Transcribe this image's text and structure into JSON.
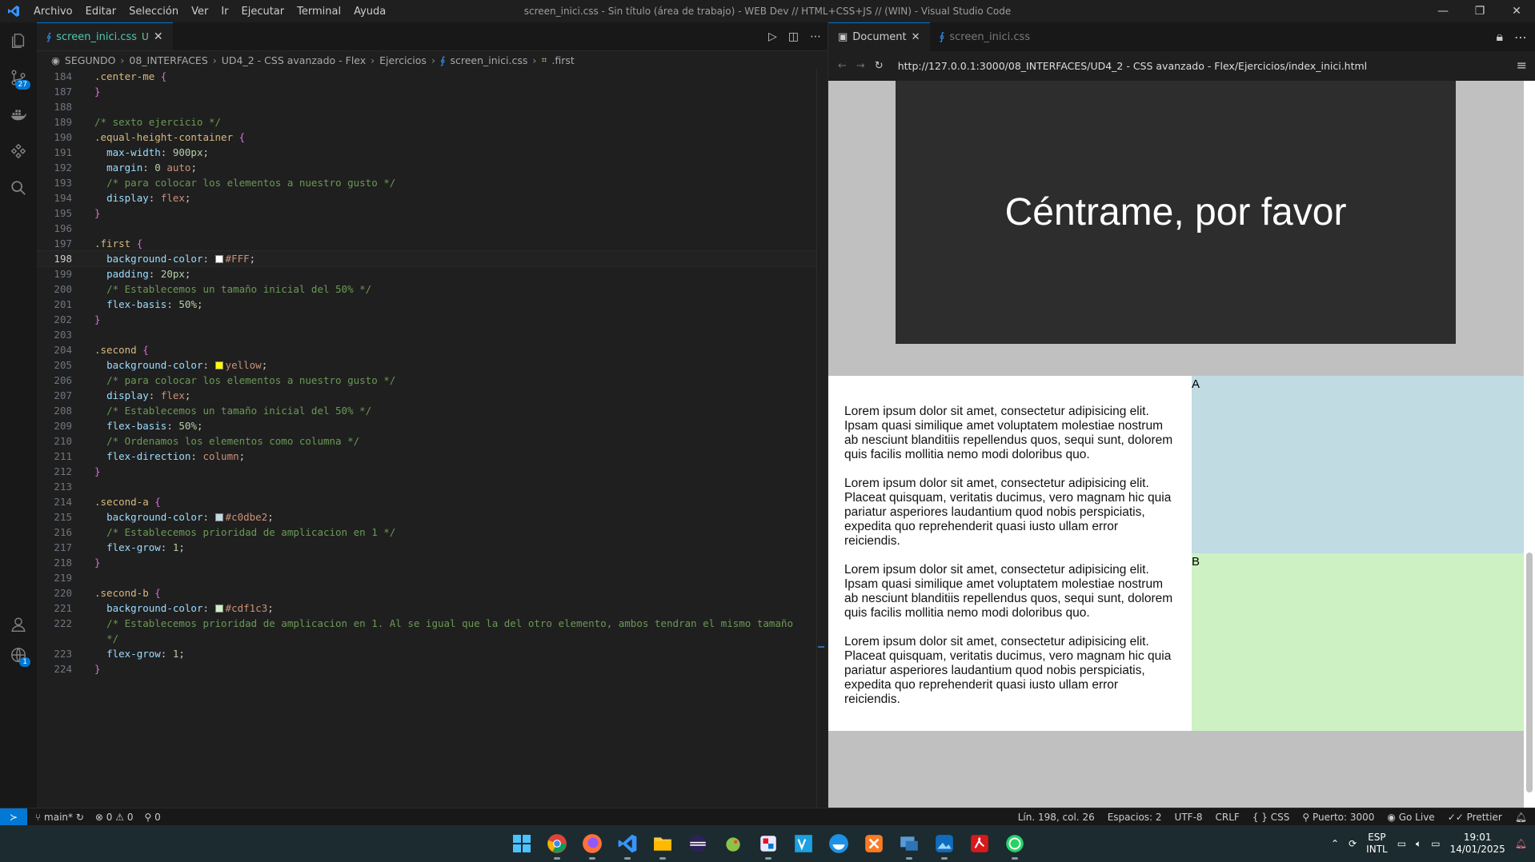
{
  "titlebar": {
    "menu": [
      "Archivo",
      "Editar",
      "Selección",
      "Ver",
      "Ir",
      "Ejecutar",
      "Terminal",
      "Ayuda"
    ],
    "title": "screen_inici.css - Sin título (área de trabajo) - WEB Dev // HTML+CSS+JS // (WIN) - Visual Studio Code",
    "controls": [
      "—",
      "❐",
      "✕"
    ]
  },
  "activity": {
    "scm_badge": "27",
    "accounts_badge": "1"
  },
  "editor": {
    "tab": {
      "label": "screen_inici.css",
      "modified": "U"
    },
    "breadcrumb": [
      "SEGUNDO",
      "08_INTERFACES",
      "UD4_2 - CSS avanzado - Flex",
      "Ejercicios",
      "screen_inici.css",
      ".first"
    ],
    "lines": [
      {
        "n": "184",
        "segs": [
          [
            "sel",
            ".center-me "
          ],
          [
            "brace",
            "{"
          ]
        ]
      },
      {
        "n": "187",
        "segs": [
          [
            "brace",
            "}"
          ]
        ]
      },
      {
        "n": "188",
        "segs": []
      },
      {
        "n": "189",
        "segs": [
          [
            "cm",
            "/* sexto ejercicio */"
          ]
        ]
      },
      {
        "n": "190",
        "segs": [
          [
            "sel",
            ".equal-height-container "
          ],
          [
            "brace",
            "{"
          ]
        ]
      },
      {
        "n": "191",
        "segs": [
          [
            "i",
            "  "
          ],
          [
            "prop",
            "max-width"
          ],
          [
            "pun",
            ": "
          ],
          [
            "num",
            "900px"
          ],
          [
            "pun",
            ";"
          ]
        ]
      },
      {
        "n": "192",
        "segs": [
          [
            "i",
            "  "
          ],
          [
            "prop",
            "margin"
          ],
          [
            "pun",
            ": "
          ],
          [
            "num",
            "0 "
          ],
          [
            "kw",
            "auto"
          ],
          [
            "pun",
            ";"
          ]
        ]
      },
      {
        "n": "193",
        "segs": [
          [
            "i",
            "  "
          ],
          [
            "cm",
            "/* para colocar los elementos a nuestro gusto */"
          ]
        ]
      },
      {
        "n": "194",
        "segs": [
          [
            "i",
            "  "
          ],
          [
            "prop",
            "display"
          ],
          [
            "pun",
            ": "
          ],
          [
            "kw",
            "flex"
          ],
          [
            "pun",
            ";"
          ]
        ]
      },
      {
        "n": "195",
        "segs": [
          [
            "brace",
            "}"
          ]
        ]
      },
      {
        "n": "196",
        "segs": []
      },
      {
        "n": "197",
        "segs": [
          [
            "sel",
            ".first "
          ],
          [
            "brace",
            "{"
          ]
        ]
      },
      {
        "n": "198",
        "current": true,
        "segs": [
          [
            "i",
            "  "
          ],
          [
            "prop",
            "background-color"
          ],
          [
            "pun",
            ": "
          ],
          [
            "sw",
            "#FFFFFF"
          ],
          [
            "kw",
            "#FFF"
          ],
          [
            "pun",
            ";"
          ]
        ]
      },
      {
        "n": "199",
        "segs": [
          [
            "i",
            "  "
          ],
          [
            "prop",
            "padding"
          ],
          [
            "pun",
            ": "
          ],
          [
            "num",
            "20px"
          ],
          [
            "pun",
            ";"
          ]
        ]
      },
      {
        "n": "200",
        "segs": [
          [
            "i",
            "  "
          ],
          [
            "cm",
            "/* Establecemos un tamaño inicial del 50% */"
          ]
        ]
      },
      {
        "n": "201",
        "segs": [
          [
            "i",
            "  "
          ],
          [
            "prop",
            "flex-basis"
          ],
          [
            "pun",
            ": "
          ],
          [
            "num",
            "50%"
          ],
          [
            "pun",
            ";"
          ]
        ]
      },
      {
        "n": "202",
        "segs": [
          [
            "brace",
            "}"
          ]
        ]
      },
      {
        "n": "203",
        "segs": []
      },
      {
        "n": "204",
        "segs": [
          [
            "sel",
            ".second "
          ],
          [
            "brace",
            "{"
          ]
        ]
      },
      {
        "n": "205",
        "segs": [
          [
            "i",
            "  "
          ],
          [
            "prop",
            "background-color"
          ],
          [
            "pun",
            ": "
          ],
          [
            "sw",
            "#FFFF00"
          ],
          [
            "kw",
            "yellow"
          ],
          [
            "pun",
            ";"
          ]
        ]
      },
      {
        "n": "206",
        "segs": [
          [
            "i",
            "  "
          ],
          [
            "cm",
            "/* para colocar los elementos a nuestro gusto */"
          ]
        ]
      },
      {
        "n": "207",
        "segs": [
          [
            "i",
            "  "
          ],
          [
            "prop",
            "display"
          ],
          [
            "pun",
            ": "
          ],
          [
            "kw",
            "flex"
          ],
          [
            "pun",
            ";"
          ]
        ]
      },
      {
        "n": "208",
        "segs": [
          [
            "i",
            "  "
          ],
          [
            "cm",
            "/* Establecemos un tamaño inicial del 50% */"
          ]
        ]
      },
      {
        "n": "209",
        "segs": [
          [
            "i",
            "  "
          ],
          [
            "prop",
            "flex-basis"
          ],
          [
            "pun",
            ": "
          ],
          [
            "num",
            "50%"
          ],
          [
            "pun",
            ";"
          ]
        ]
      },
      {
        "n": "210",
        "segs": [
          [
            "i",
            "  "
          ],
          [
            "cm",
            "/* Ordenamos los elementos como columna */"
          ]
        ]
      },
      {
        "n": "211",
        "segs": [
          [
            "i",
            "  "
          ],
          [
            "prop",
            "flex-direction"
          ],
          [
            "pun",
            ": "
          ],
          [
            "kw",
            "column"
          ],
          [
            "pun",
            ";"
          ]
        ]
      },
      {
        "n": "212",
        "segs": [
          [
            "brace",
            "}"
          ]
        ]
      },
      {
        "n": "213",
        "segs": []
      },
      {
        "n": "214",
        "segs": [
          [
            "sel",
            ".second-a "
          ],
          [
            "brace",
            "{"
          ]
        ]
      },
      {
        "n": "215",
        "segs": [
          [
            "i",
            "  "
          ],
          [
            "prop",
            "background-color"
          ],
          [
            "pun",
            ": "
          ],
          [
            "sw",
            "#c0dbe2"
          ],
          [
            "kw",
            "#c0dbe2"
          ],
          [
            "pun",
            ";"
          ]
        ]
      },
      {
        "n": "216",
        "segs": [
          [
            "i",
            "  "
          ],
          [
            "cm",
            "/* Establecemos prioridad de amplicacion en 1 */"
          ]
        ]
      },
      {
        "n": "217",
        "segs": [
          [
            "i",
            "  "
          ],
          [
            "prop",
            "flex-grow"
          ],
          [
            "pun",
            ": "
          ],
          [
            "num",
            "1"
          ],
          [
            "pun",
            ";"
          ]
        ]
      },
      {
        "n": "218",
        "segs": [
          [
            "brace",
            "}"
          ]
        ]
      },
      {
        "n": "219",
        "segs": []
      },
      {
        "n": "220",
        "segs": [
          [
            "sel",
            ".second-b "
          ],
          [
            "brace",
            "{"
          ]
        ]
      },
      {
        "n": "221",
        "segs": [
          [
            "i",
            "  "
          ],
          [
            "prop",
            "background-color"
          ],
          [
            "pun",
            ": "
          ],
          [
            "sw",
            "#cdf1c3"
          ],
          [
            "kw",
            "#cdf1c3"
          ],
          [
            "pun",
            ";"
          ]
        ]
      },
      {
        "n": "222",
        "segs": [
          [
            "i",
            "  "
          ],
          [
            "cm",
            "/* Establecemos prioridad de amplicacion en 1. Al se igual que la del otro elemento, ambos tendran el mismo tamaño"
          ]
        ]
      },
      {
        "n": "",
        "segs": [
          [
            "i",
            "  "
          ],
          [
            "cm",
            "*/"
          ]
        ]
      },
      {
        "n": "223",
        "segs": [
          [
            "i",
            "  "
          ],
          [
            "prop",
            "flex-grow"
          ],
          [
            "pun",
            ": "
          ],
          [
            "num",
            "1"
          ],
          [
            "pun",
            ";"
          ]
        ]
      },
      {
        "n": "224",
        "segs": [
          [
            "brace",
            "}"
          ]
        ]
      }
    ]
  },
  "browser": {
    "tabs": [
      "Document",
      "screen_inici.css"
    ],
    "url": "http://127.0.0.1:3000/08_INTERFACES/UD4_2 - CSS avanzado - Flex/Ejercicios/index_inici.html",
    "page": {
      "heading": "Céntrame, por favor",
      "paragraphs": [
        "Lorem ipsum dolor sit amet, consectetur adipisicing elit. Ipsam quasi similique amet voluptatem molestiae nostrum ab nesciunt blanditiis repellendus quos, sequi sunt, dolorem quis facilis mollitia nemo modi doloribus quo.",
        "Lorem ipsum dolor sit amet, consectetur adipisicing elit. Placeat quisquam, veritatis ducimus, vero magnam hic quia pariatur asperiores laudantium quod nobis perspiciatis, expedita quo reprehenderit quasi iusto ullam error reiciendis.",
        "Lorem ipsum dolor sit amet, consectetur adipisicing elit. Ipsam quasi similique amet voluptatem molestiae nostrum ab nesciunt blanditiis repellendus quos, sequi sunt, dolorem quis facilis mollitia nemo modi doloribus quo.",
        "Lorem ipsum dolor sit amet, consectetur adipisicing elit. Placeat quisquam, veritatis ducimus, vero magnam hic quia pariatur asperiores laudantium quod nobis perspiciatis, expedita quo reprehenderit quasi iusto ullam error reiciendis."
      ],
      "label_a": "A",
      "label_b": "B"
    }
  },
  "status": {
    "branch": "main*",
    "errors": "0",
    "warnings": "0",
    "ports": "0",
    "position": "Lín. 198, col. 26",
    "spaces": "Espacios: 2",
    "encoding": "UTF-8",
    "eol": "CRLF",
    "language": "CSS",
    "port": "Puerto: 3000",
    "golive": "Go Live",
    "prettier": "Prettier"
  },
  "taskbar": {
    "lang1": "ESP",
    "lang2": "INTL",
    "time": "19:01",
    "date": "14/01/2025"
  },
  "colors": {
    "accent": "#0078d4",
    "second_a": "#c0dbe2",
    "second_b": "#cdf1c3"
  }
}
